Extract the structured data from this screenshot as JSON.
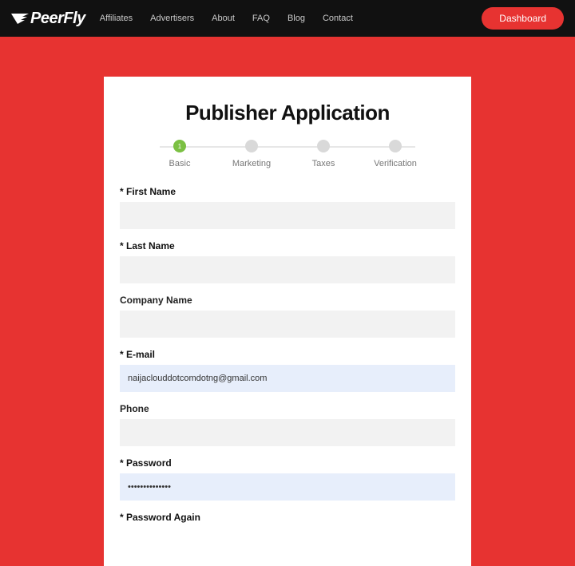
{
  "brand": "PeerFly",
  "nav": {
    "affiliates": "Affiliates",
    "advertisers": "Advertisers",
    "about": "About",
    "faq": "FAQ",
    "blog": "Blog",
    "contact": "Contact"
  },
  "dashboard_btn": "Dashboard",
  "form": {
    "title": "Publisher Application",
    "steps": {
      "s1": {
        "num": "1",
        "label": "Basic"
      },
      "s2": {
        "label": "Marketing"
      },
      "s3": {
        "label": "Taxes"
      },
      "s4": {
        "label": "Verification"
      }
    },
    "fields": {
      "first_name": {
        "label": "* First Name",
        "value": ""
      },
      "last_name": {
        "label": "* Last Name",
        "value": ""
      },
      "company": {
        "label": "Company Name",
        "value": ""
      },
      "email": {
        "label": "* E-mail",
        "value": "naijaclouddotcomdotng@gmail.com"
      },
      "phone": {
        "label": "Phone",
        "value": ""
      },
      "password": {
        "label": "* Password",
        "value": "••••••••••••••"
      },
      "password2": {
        "label": "* Password Again",
        "value": ""
      }
    }
  }
}
